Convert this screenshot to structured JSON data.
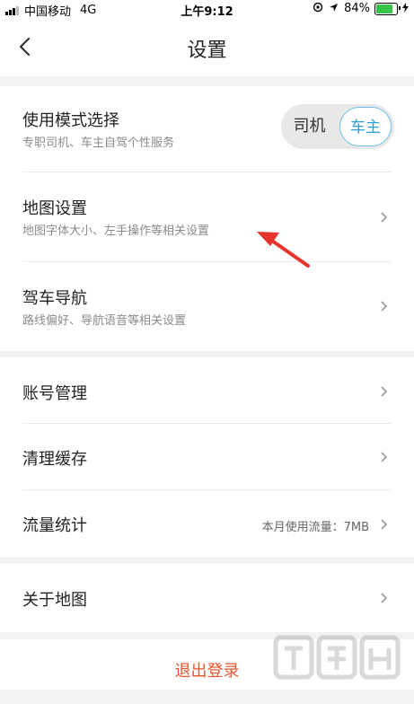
{
  "status_bar": {
    "carrier": "中国移动",
    "network": "4G",
    "time": "上午9:12",
    "battery": "84%",
    "battery_level": 0.84,
    "battery_color": "#39c24a"
  },
  "nav": {
    "title": "设置"
  },
  "group1": {
    "mode": {
      "title": "使用模式选择",
      "subtitle": "专职司机、车主自驾个性服务",
      "toggle": {
        "option_left": "司机",
        "option_right": "车主",
        "selected": "车主"
      }
    },
    "map_settings": {
      "title": "地图设置",
      "subtitle": "地图字体大小、左手操作等相关设置"
    },
    "driving_nav": {
      "title": "驾车导航",
      "subtitle": "路线偏好、导航语音等相关设置"
    }
  },
  "group2": {
    "account": {
      "title": "账号管理"
    },
    "cache": {
      "title": "清理缓存"
    },
    "traffic": {
      "title": "流量统计",
      "value": "本月使用流量：7MB"
    }
  },
  "group3": {
    "about": {
      "title": "关于地图"
    }
  },
  "logout": {
    "label": "退出登录",
    "color": "#e8552c"
  },
  "colors": {
    "accent": "#2aa0d8",
    "arrow": "#e8332c",
    "background": "#f2f2f2"
  }
}
